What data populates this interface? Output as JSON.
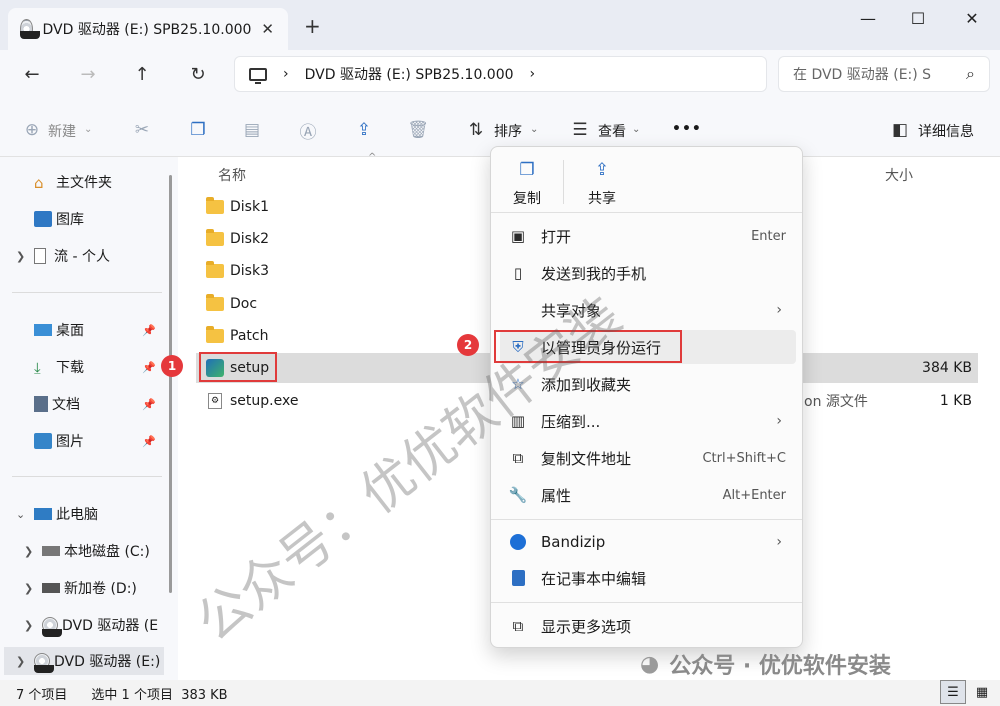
{
  "window": {
    "tab_title": "DVD 驱动器 (E:) SPB25.10.000",
    "tab_close": "✕",
    "new_tab": "+",
    "minimize": "—",
    "maximize": "☐",
    "close": "✕"
  },
  "nav": {
    "back": "←",
    "forward": "→",
    "up": "↑",
    "refresh": "↻"
  },
  "address": {
    "chevron": "›",
    "path": "DVD 驱动器 (E:) SPB25.10.000",
    "end_chevron": "›",
    "search_placeholder": "在 DVD 驱动器 (E:) S",
    "search_icon": "⌕"
  },
  "toolbar": {
    "new_label": "新建",
    "sort_label": "排序",
    "view_label": "查看",
    "more_label": "•••",
    "details_label": "详细信息"
  },
  "sidebar": {
    "home": "主文件夹",
    "gallery": "图库",
    "personal": "流 - 个人",
    "desktop": "桌面",
    "downloads": "下载",
    "documents": "文档",
    "pictures": "图片",
    "this_pc": "此电脑",
    "drive_c": "本地磁盘 (C:)",
    "drive_d": "新加卷 (D:)",
    "drive_e_child": "DVD 驱动器 (E",
    "drive_e": "DVD 驱动器 (E:)"
  },
  "list": {
    "col_name": "名称",
    "col_size": "大小",
    "rows": [
      {
        "name": "Disk1",
        "type": "",
        "size": ""
      },
      {
        "name": "Disk2",
        "type": "",
        "size": ""
      },
      {
        "name": "Disk3",
        "type": "",
        "size": ""
      },
      {
        "name": "Doc",
        "type": "",
        "size": ""
      },
      {
        "name": "Patch",
        "type": "",
        "size": ""
      },
      {
        "name": "setup",
        "type": "",
        "size": "384 KB"
      },
      {
        "name": "setup.exe",
        "type": "on 源文件",
        "size": "1 KB"
      }
    ]
  },
  "context_menu": {
    "copy": "复制",
    "share": "共享",
    "items": [
      {
        "label": "打开",
        "shortcut": "Enter"
      },
      {
        "label": "发送到我的手机",
        "shortcut": ""
      },
      {
        "label": "共享对象",
        "shortcut": "›"
      },
      {
        "label": "以管理员身份运行",
        "shortcut": ""
      },
      {
        "label": "添加到收藏夹",
        "shortcut": ""
      },
      {
        "label": "压缩到...",
        "shortcut": "›"
      },
      {
        "label": "复制文件地址",
        "shortcut": "Ctrl+Shift+C"
      },
      {
        "label": "属性",
        "shortcut": "Alt+Enter"
      },
      {
        "label": "Bandizip",
        "shortcut": "›"
      },
      {
        "label": "在记事本中编辑",
        "shortcut": ""
      },
      {
        "label": "显示更多选项",
        "shortcut": ""
      }
    ]
  },
  "annotations": {
    "badge1": "1",
    "badge2": "2",
    "accent": "#e03b3b"
  },
  "status": {
    "count": "7 个项目",
    "selected": "选中 1 个项目  383 KB"
  },
  "watermark": {
    "diagonal": "公众号：优优软件安装",
    "footer": "公众号 · 优优软件安装"
  }
}
